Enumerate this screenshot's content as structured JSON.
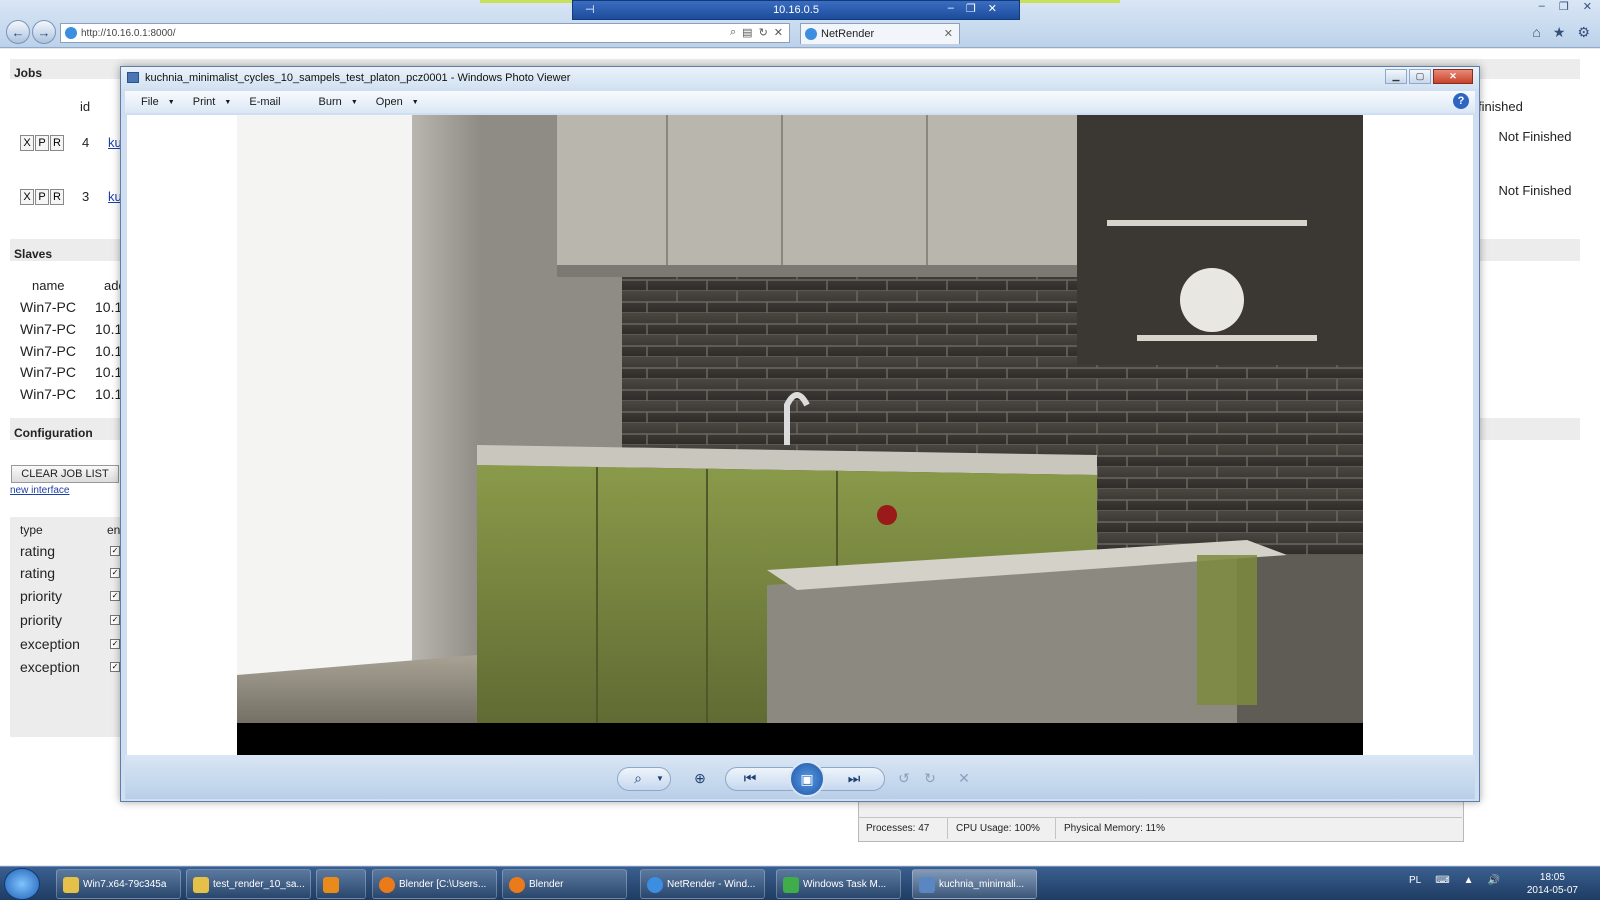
{
  "rdp": {
    "host": "10.16.0.5"
  },
  "browser": {
    "url": "http://10.16.0.1:8000/",
    "tab_title": "NetRender"
  },
  "netrender": {
    "jobs_heading": "Jobs",
    "jobs_col_id": "id",
    "jobs_col_finished": "finished",
    "job_actions": [
      "X",
      "P",
      "R"
    ],
    "jobs": [
      {
        "id": "4",
        "name_fragment": "ku",
        "finished": "Not Finished"
      },
      {
        "id": "3",
        "name_fragment": "ku",
        "finished": "Not Finished"
      }
    ],
    "slaves_heading": "Slaves",
    "slaves_col_name": "name",
    "slaves_col_address": "add",
    "slaves": [
      {
        "name": "Win7-PC",
        "address": "10.1"
      },
      {
        "name": "Win7-PC",
        "address": "10.1"
      },
      {
        "name": "Win7-PC",
        "address": "10.1"
      },
      {
        "name": "Win7-PC",
        "address": "10.1"
      },
      {
        "name": "Win7-PC",
        "address": "10.1"
      }
    ],
    "config_heading": "Configuration",
    "clear_button": "CLEAR JOB LIST",
    "new_interface_link": "new interface",
    "filters_col_type": "type",
    "filters_col_enabled": "en",
    "filters": [
      {
        "type": "rating",
        "checked": true
      },
      {
        "type": "rating",
        "checked": true
      },
      {
        "type": "priority",
        "checked": true
      },
      {
        "type": "priority",
        "checked": true
      },
      {
        "type": "exception",
        "checked": true
      },
      {
        "type": "exception",
        "checked": true
      }
    ]
  },
  "photo_viewer": {
    "title": "kuchnia_minimalist_cycles_10_sampels_test_platon_pcz0001 - Windows Photo Viewer",
    "menu": [
      "File",
      "Print",
      "E-mail",
      "Burn",
      "Open"
    ],
    "help_icon": "help-icon"
  },
  "task_manager": {
    "processes": "Processes: 47",
    "cpu": "CPU Usage: 100%",
    "memory": "Physical Memory: 11%"
  },
  "taskbar": {
    "items": [
      "Win7.x64-79c345a",
      "test_render_10_sa...",
      "",
      "Blender [C:\\Users...",
      "Blender",
      "NetRender - Wind...",
      "Windows Task M...",
      "kuchnia_minimali..."
    ],
    "language": "PL",
    "time": "18:05",
    "date": "2014-05-07"
  }
}
